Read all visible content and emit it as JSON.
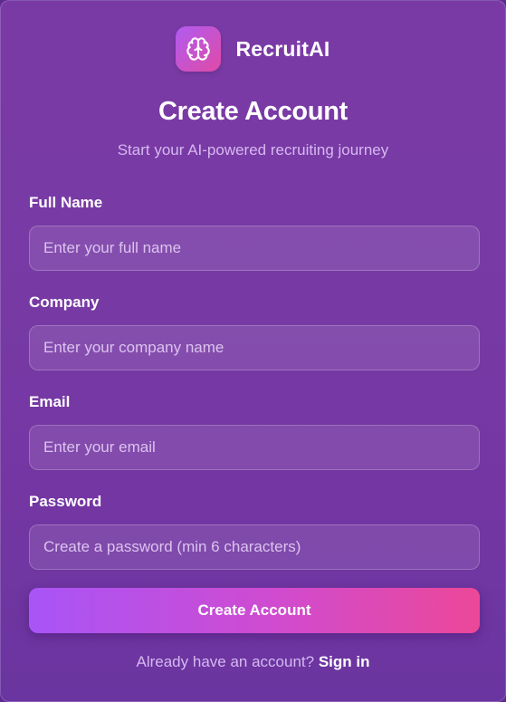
{
  "brand": {
    "name": "RecruitAI",
    "logo_icon": "brain-icon",
    "logo_gradient": [
      "#b05cf2",
      "#e04aa5"
    ]
  },
  "header": {
    "title": "Create Account",
    "subtitle": "Start your AI-powered recruiting journey"
  },
  "form": {
    "full_name": {
      "label": "Full Name",
      "value": "",
      "placeholder": "Enter your full name"
    },
    "company": {
      "label": "Company",
      "value": "",
      "placeholder": "Enter your company name"
    },
    "email": {
      "label": "Email",
      "value": "",
      "placeholder": "Enter your email"
    },
    "password": {
      "label": "Password",
      "value": "",
      "placeholder": "Create a password (min 6 characters)"
    },
    "submit_label": "Create Account",
    "submit_gradient": [
      "#a855f7",
      "#ec4899"
    ]
  },
  "footer": {
    "prompt": "Already have an account?",
    "link_label": "Sign in"
  },
  "colors": {
    "background": "#7a3aa6",
    "accent_text": "#d6b8f0"
  }
}
